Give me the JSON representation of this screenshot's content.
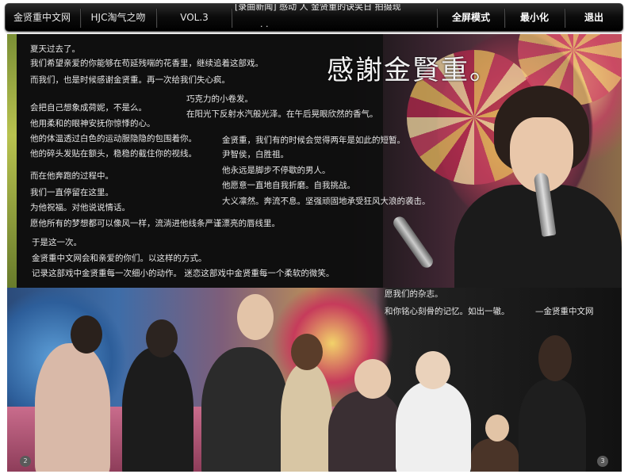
{
  "nav": {
    "items": [
      {
        "label": "金贤重中文网"
      },
      {
        "label": "HJC淘气之吻"
      },
      {
        "label": "VOL.3"
      }
    ],
    "marquee_row1": "[录曲新闻]    感动    人 金贤重的诀笑日 拍摄现",
    "marquee_row2": "      ·    ·         ",
    "fullscreen_label": "全屏模式",
    "minimize_label": "最小化",
    "exit_label": "退出"
  },
  "article": {
    "headline": "感謝金賢重。",
    "left_lines": [
      "夏天过去了。",
      "我们希望亲爱的你能够在苟延残喘的花香里，继续追着这部戏。",
      "而我们，也是时候感谢金贤重。再一次给我们失心疯。",
      "会把自己想象成荷妮，不是么。",
      "他用柔和的眼神安抚你惊悸的心。",
      "他的体温透过白色的运动服隐隐的包围着你。",
      "他的碎头发贴在额头，稳稳的截住你的视线。",
      "而在他奔跑的过程中。",
      "我们一直停留在这里。",
      "为他祝福。对他说说情话。",
      "愿他所有的梦想都可以像风一样，流淌进他线条严谨漂亮的唇线里。",
      "于是这一次。",
      "金贤重中文网会和亲爱的你们。以这样的方式。",
      "记录这部戏中金贤重每一次细小的动作。 迷恋这部戏中金贤重每一个柔软的微笑。"
    ],
    "middle_lines": [
      "巧克力的小卷发。",
      "在阳光下反射水汽般光泽。在午后晃眼欣然的香气。",
      "金贤重，我们有的时候会觉得两年是如此的短暂。",
      "尹智侯，白胜祖。",
      "他永远是脚步不停歇的男人。",
      "他愿意一直地自我折磨。自我挑战。",
      "大义凛然。奔流不息。坚强顽固地承受狂风大浪的袭击。"
    ],
    "caption_lines": [
      "愿我们的杂志。",
      "和你铭心刻骨的记忆。如出一辙。"
    ],
    "signature": "—金贤重中文网"
  },
  "pager": {
    "prev_label": "2",
    "next_label": "3"
  },
  "colors": {
    "nav_bg": "#0c0c0c",
    "text_light": "#e6e6e6",
    "panel_bg": "#0f0f0f"
  }
}
